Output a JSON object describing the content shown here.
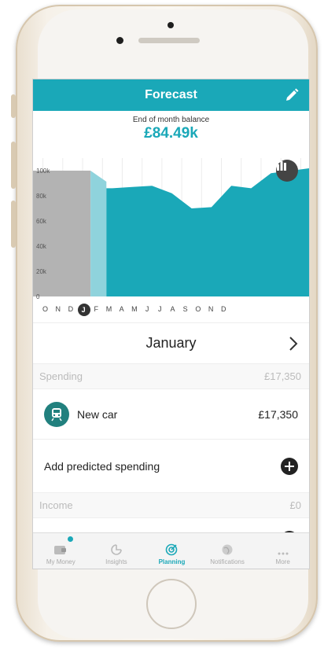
{
  "header": {
    "title": "Forecast"
  },
  "balance": {
    "label": "End of month balance",
    "value": "£84.49k"
  },
  "chart_data": {
    "type": "area",
    "categories": [
      "O",
      "N",
      "D",
      "J",
      "F",
      "M",
      "A",
      "M",
      "J",
      "J",
      "A",
      "S",
      "O",
      "N",
      "D"
    ],
    "values": [
      100,
      100,
      100,
      100,
      86,
      87,
      88,
      82,
      70,
      71,
      88,
      86,
      98,
      100,
      102
    ],
    "ylabels": [
      "100k",
      "80k",
      "60k",
      "40k",
      "20k",
      "0"
    ],
    "ylim": [
      0,
      110
    ],
    "history_months": 3,
    "selected_index": 3,
    "colors": {
      "history": "#b3b3b3",
      "current": "#8fd3dc",
      "forecast": "#1aa8b8"
    }
  },
  "months": [
    "O",
    "N",
    "D",
    "J",
    "F",
    "M",
    "A",
    "M",
    "J",
    "J",
    "A",
    "S",
    "O",
    "N",
    "D"
  ],
  "selected_month": "January",
  "spending": {
    "label": "Spending",
    "total": "£17,350"
  },
  "item": {
    "name": "New car",
    "amount": "£17,350",
    "icon": "train-icon"
  },
  "add_spending": {
    "label": "Add predicted spending"
  },
  "income": {
    "label": "Income",
    "total": "£0"
  },
  "tabs": [
    {
      "label": "My Money",
      "icon": "wallet-icon"
    },
    {
      "label": "Insights",
      "icon": "insights-icon"
    },
    {
      "label": "Planning",
      "icon": "target-icon"
    },
    {
      "label": "Notifications",
      "icon": "globe-icon"
    },
    {
      "label": "More",
      "icon": "more-icon"
    }
  ]
}
